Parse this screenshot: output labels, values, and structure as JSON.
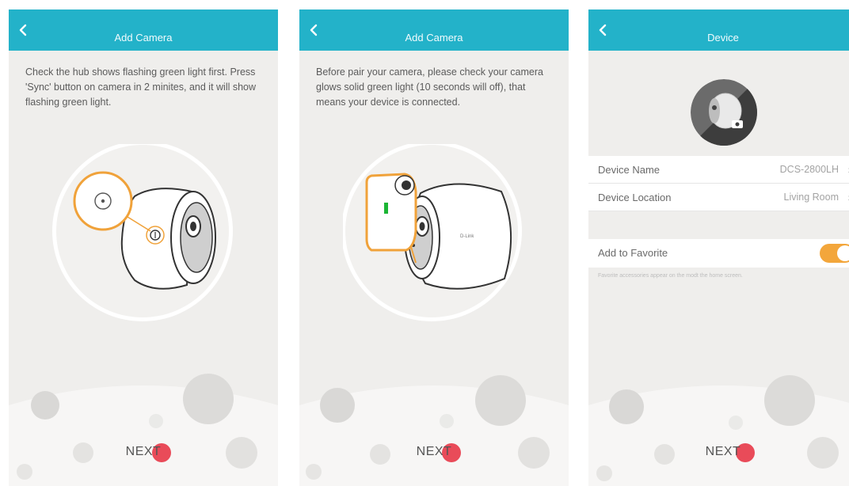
{
  "colors": {
    "header": "#23b2c9",
    "accent_dot": "#e94b59",
    "toggle_on": "#f3a63b",
    "background": "#efeeec"
  },
  "screen1": {
    "title": "Add Camera",
    "back_icon": "chevron-left-icon",
    "instruction": "Check the hub shows flashing green light first. Press 'Sync' button on camera in 2 minites, and it will show flashing green light.",
    "next_label": "NEXT"
  },
  "screen2": {
    "title": "Add Camera",
    "back_icon": "chevron-left-icon",
    "instruction": "Before pair your camera, please check your camera glows solid green light (10 seconds will off), that means your device is connected.",
    "camera_brand": "D-Link",
    "next_label": "NEXT"
  },
  "screen3": {
    "title": "Device",
    "back_icon": "chevron-left-icon",
    "rows": [
      {
        "label": "Device Name",
        "value": "DCS-2800LH"
      },
      {
        "label": "Device Location",
        "value": "Living Room"
      }
    ],
    "favorite": {
      "label": "Add to Favorite",
      "enabled": true,
      "hint": "Favorite accessories appear on the modt the home screen."
    },
    "next_label": "NEXT"
  }
}
